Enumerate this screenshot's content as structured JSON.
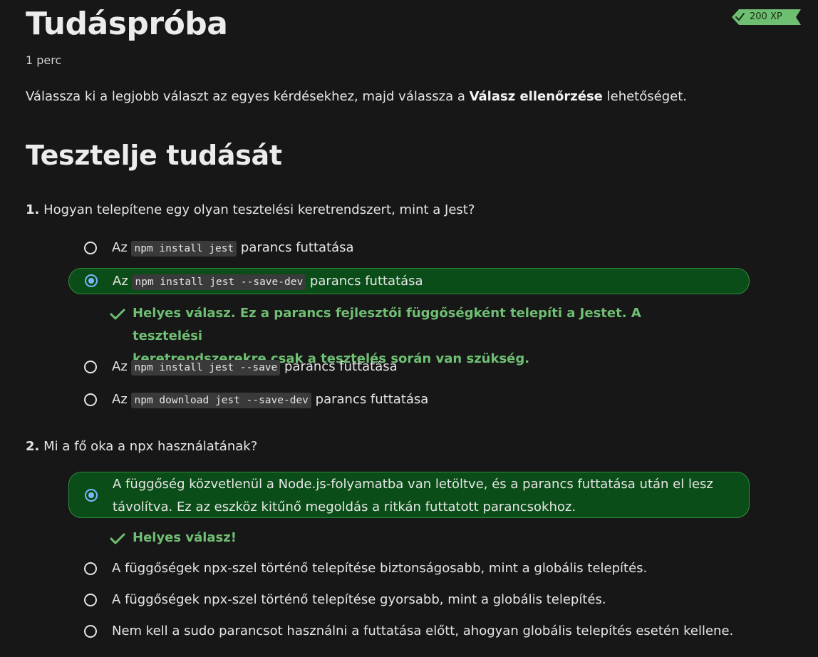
{
  "page": {
    "title": "Tudáspróba",
    "duration": "1 perc",
    "xp": "200 XP",
    "intro_before": "Válassza ki a legjobb választ az egyes kérdésekhez, majd válassza a ",
    "intro_bold": "Válasz ellenőrzése",
    "intro_after": " lehetőséget.",
    "section_title": "Tesztelje tudását"
  },
  "colors": {
    "selected_bg": "#0b4d18",
    "correct_text": "#6fbf73",
    "xp_badge": "#6fbf73",
    "radio_selected": "#79b8ff"
  },
  "questions": [
    {
      "number": "1.",
      "text": "Hogyan telepítene egy olyan tesztelési keretrendszert, mint a Jest?",
      "options": [
        {
          "prefix": "Az ",
          "code": "npm install jest",
          "suffix": " parancs futtatása"
        },
        {
          "prefix": "Az ",
          "code": "npm install jest --save-dev",
          "suffix": " parancs futtatása",
          "selected": true
        },
        {
          "prefix": "Az ",
          "code": "npm install jest --save",
          "suffix": " parancs futtatása"
        },
        {
          "prefix": "Az ",
          "code": "npm download jest --save-dev",
          "suffix": " parancs futtatása"
        }
      ],
      "feedback_line1": "Helyes válasz. Ez a parancs fejlesztői függőségként telepíti a Jestet. A tesztelési",
      "feedback_line2": "keretrendszerekre csak a tesztelés során van szükség."
    },
    {
      "number": "2.",
      "text": "Mi a fő oka a npx használatának?",
      "options": [
        {
          "line1": "A függőség közvetlenül a Node.js-folyamatba van letöltve, és a parancs futtatása után el lesz",
          "line2": "távolítva. Ez az eszköz kitűnő megoldás a ritkán futtatott parancsokhoz.",
          "selected": true
        },
        {
          "line1": "A függőségek npx-szel történő telepítése biztonságosabb, mint a globális telepítés."
        },
        {
          "line1": "A függőségek npx-szel történő telepítése gyorsabb, mint a globális telepítés."
        },
        {
          "line1": "Nem kell a sudo parancsot használni a futtatása előtt, ahogyan globális telepítés esetén kellene."
        }
      ],
      "feedback": "Helyes válasz!"
    }
  ]
}
